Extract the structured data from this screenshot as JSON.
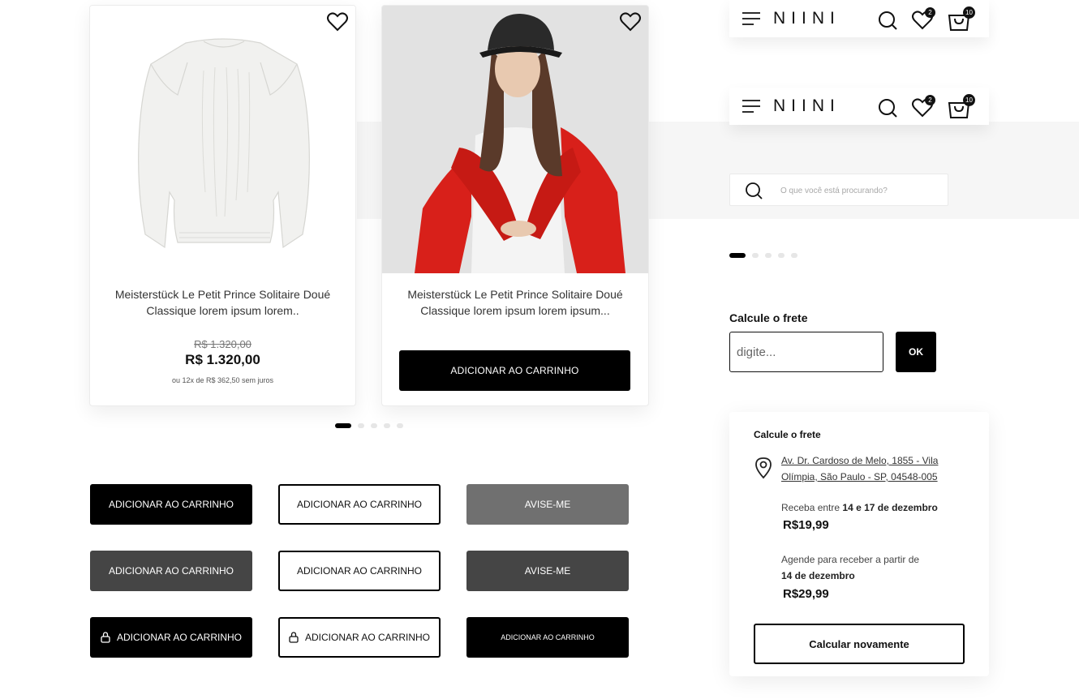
{
  "products": [
    {
      "name": "Meisterstück Le Petit Prince Solitaire Doué Classique lorem ipsum lorem..",
      "old_price": "R$ 1.320,00",
      "price": "R$ 1.320,00",
      "installments": "ou 12x de R$ 362,50 sem juros",
      "image": "white-knit-sweater",
      "icon": "heart-icon"
    },
    {
      "name": "Meisterstück Le Petit Prince Solitaire Doué Classique lorem ipsum lorem ipsum...",
      "button_label": "ADICIONAR AO CARRINHO",
      "image": "woman-red-jacket-bucket-hat",
      "icon": "heart-icon"
    }
  ],
  "carousel_dots": {
    "count": 5,
    "active_index": 0
  },
  "buttons": {
    "row1": [
      "ADICIONAR AO CARRINHO",
      "ADICIONAR AO CARRINHO",
      "AVISE-ME"
    ],
    "row2": [
      "ADICIONAR AO CARRINHO",
      "ADICIONAR AO CARRINHO",
      "AVISE-ME"
    ],
    "row3": [
      "ADICIONAR AO CARRINHO",
      "ADICIONAR AO CARRINHO",
      "ADICIONAR AO CARRINHO"
    ]
  },
  "header": {
    "logo": "NIINI",
    "wishlist_count": "2",
    "cart_count": "10",
    "icons": [
      "menu-icon",
      "search-icon",
      "heart-icon",
      "bag-icon"
    ]
  },
  "search": {
    "placeholder": "O que você está procurando?"
  },
  "side_dots": {
    "count": 5,
    "active_index": 0
  },
  "shipping_form": {
    "title": "Calcule o frete",
    "placeholder": "digite...",
    "button": "OK"
  },
  "shipping_result": {
    "title": "Calcule o frete",
    "address": "Av. Dr. Cardoso de Melo, 1855 - Vila Olímpia, São Paulo - SP, 04548-005",
    "option1_prefix": "Receba entre ",
    "option1_bold": "14 e 17 de dezembro",
    "option1_price": "R$19,99",
    "option2_prefix": "Agende para receber a partir de",
    "option2_bold": "14 de dezembro",
    "option2_price": "R$29,99",
    "button": "Calcular novamente"
  },
  "colors": {
    "primary": "#000000",
    "dark_gray": "#454545",
    "gray": "#707070",
    "accent_red": "#d8201a"
  }
}
